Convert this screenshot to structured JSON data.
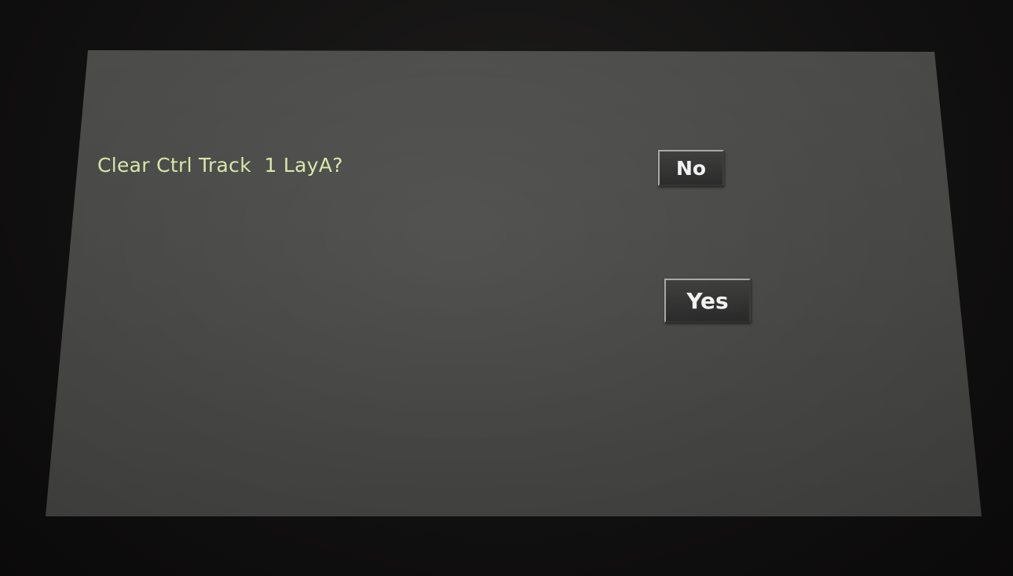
{
  "dialog": {
    "prompt": "Clear Ctrl Track  1 LayA?",
    "no_label": "No",
    "yes_label": "Yes"
  },
  "colors": {
    "prompt_text": "#d7e6a6",
    "screen_background": "#474745",
    "bezel": "#121110",
    "button_background": "#2a2a29",
    "button_text": "#f2f2f2"
  }
}
